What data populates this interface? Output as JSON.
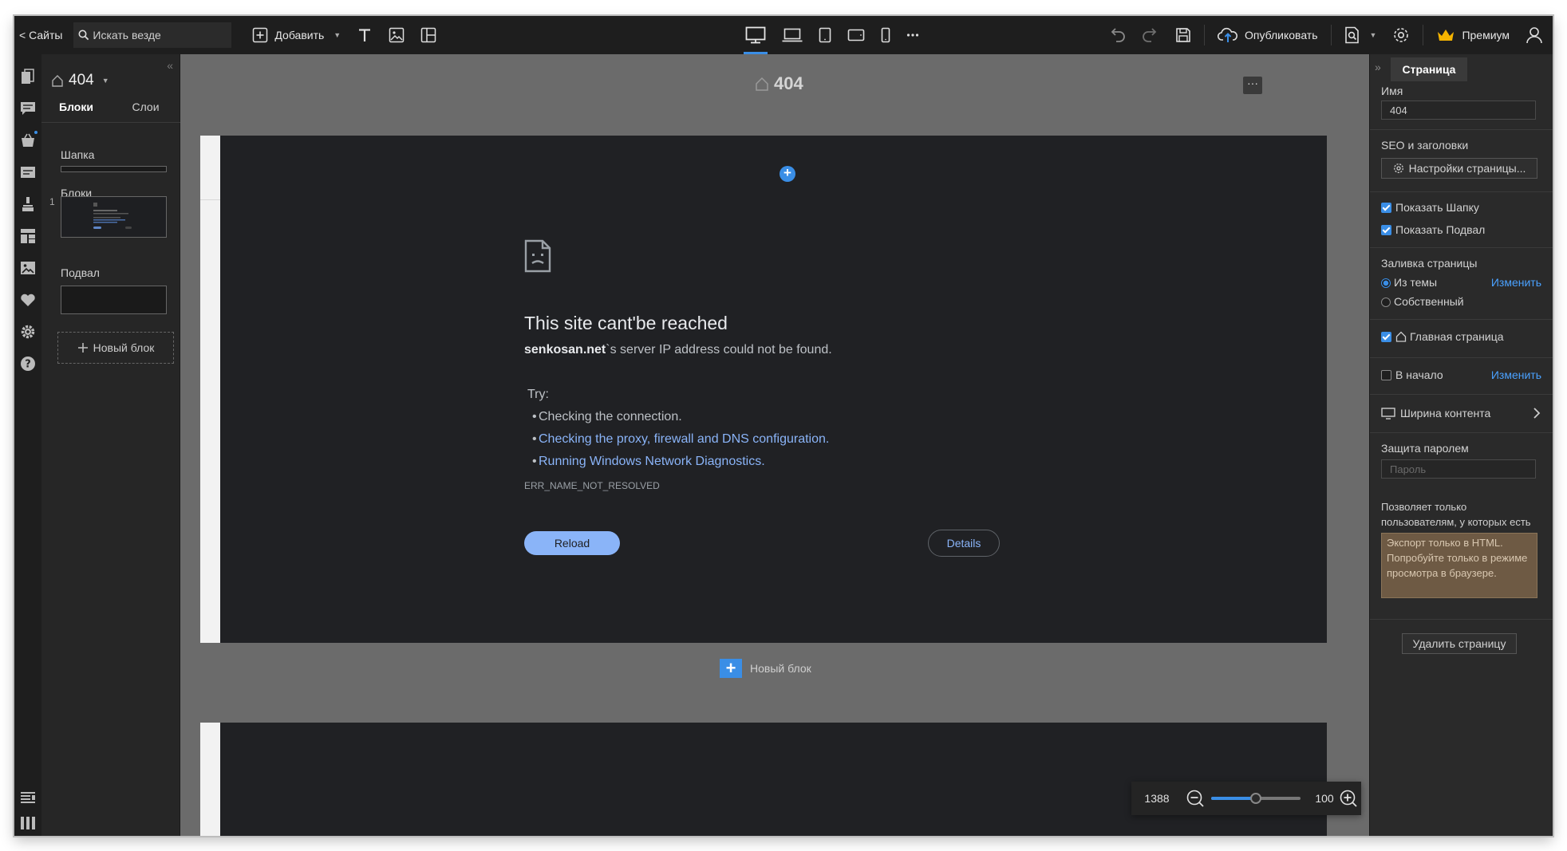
{
  "topbar": {
    "sites_label": "< Сайты",
    "search_placeholder": "Искать везде",
    "add_label": "Добавить",
    "publish_label": "Опубликовать",
    "premium_label": "Премиум"
  },
  "left_panel": {
    "page_name": "404",
    "tabs": [
      "Блоки",
      "Слои"
    ],
    "header_label": "Шапка",
    "blocks_label": "Блоки",
    "block_number": "1",
    "footer_label": "Подвал",
    "new_block_label": "Новый блок"
  },
  "canvas": {
    "page_title": "404",
    "more_label": "···",
    "error": {
      "title": "This site cant'be reached",
      "host": "senkosan.net",
      "message": "`s server IP address could not be found.",
      "try_label": "Try:",
      "items": [
        "Checking the connection.",
        "Checking the proxy, firewall and DNS configuration.",
        "Running Windows Network Diagnostics."
      ],
      "code": "ERR_NAME_NOT_RESOLVED",
      "reload_label": "Reload",
      "details_label": "Details"
    },
    "new_block_label": "Новый блок"
  },
  "zoom": {
    "width_value": "1388",
    "zoom_value": "100",
    "slider_fraction": 0.5
  },
  "right_panel": {
    "tab_label": "Страница",
    "name_label": "Имя",
    "name_value": "404",
    "seo_label": "SEO и заголовки",
    "page_settings_label": "Настройки страницы...",
    "show_header_label": "Показать Шапку",
    "show_footer_label": "Показать Подвал",
    "fill_label": "Заливка страницы",
    "from_theme_label": "Из темы",
    "change_label": "Изменить",
    "own_label": "Собственный",
    "home_page_label": "Главная страница",
    "to_start_label": "В начало",
    "change_label_2": "Изменить",
    "content_width_label": "Ширина контента",
    "password_label": "Защита паролем",
    "password_placeholder": "Пароль",
    "password_help": "Позволяет только пользователям, у которых есть пароль, посещать эту страницу.",
    "export_note": "Экспорт только в HTML. Попробуйте только в режиме просмотра в браузере.",
    "delete_label": "Удалить страницу"
  },
  "colors": {
    "accent": "#3a8ee6",
    "link": "#8ab4f8",
    "premium_crown": "#f5b400",
    "note_bg": "#6e5a44"
  },
  "icons": [
    "search-icon",
    "add-icon",
    "text-icon",
    "image-icon",
    "layout-icon",
    "desktop-icon",
    "laptop-icon",
    "tablet-icon",
    "tablet-landscape-icon",
    "phone-icon",
    "more-icon",
    "undo-icon",
    "redo-icon",
    "save-icon",
    "cloud-upload-icon",
    "preview-icon",
    "gear-icon",
    "crown-icon",
    "user-icon",
    "home-icon",
    "chevron-right-icon",
    "sad-page-icon",
    "zoom-out-icon",
    "zoom-in-icon"
  ]
}
